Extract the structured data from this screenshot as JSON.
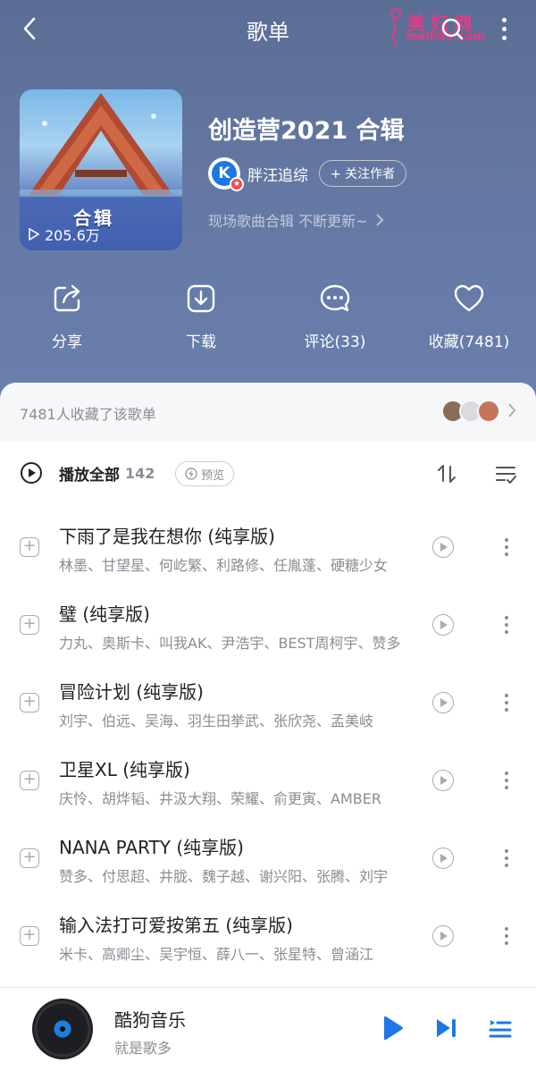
{
  "header": {
    "title": "歌单",
    "watermark_main": "美妇网",
    "watermark_sub": "meili43.com"
  },
  "album": {
    "cover_label": "合辑",
    "plays": "205.6万",
    "title": "创造营2021 合辑",
    "author": "胖汪追综",
    "follow_label": "+ 关注作者",
    "description": "现场歌曲合辑 不断更新~"
  },
  "actions": [
    {
      "label": "分享",
      "icon": "share-icon"
    },
    {
      "label": "下载",
      "icon": "download-icon"
    },
    {
      "label": "评论(33)",
      "icon": "comment-icon"
    },
    {
      "label": "收藏(7481)",
      "icon": "heart-icon"
    }
  ],
  "favorites": {
    "text": "7481人收藏了该歌单"
  },
  "playlist": {
    "play_all_label": "播放全部",
    "count": "142",
    "preview_label": "预览",
    "songs": [
      {
        "title": "下雨了是我在想你 (纯享版)",
        "artists": "林墨、甘望星、何屹繁、利路修、任胤蓬、硬糖少女"
      },
      {
        "title": "璧 (纯享版)",
        "artists": "力丸、奥斯卡、叫我AK、尹浩宇、BEST周柯宇、赞多"
      },
      {
        "title": "冒险计划 (纯享版)",
        "artists": "刘宇、伯远、吴海、羽生田挙武、张欣尧、孟美岐"
      },
      {
        "title": "卫星XL (纯享版)",
        "artists": "庆怜、胡烨韬、井汲大翔、荣耀、俞更寅、AMBER"
      },
      {
        "title": "NANA PARTY (纯享版)",
        "artists": "赞多、付思超、井胧、魏子越、谢兴阳、张腾、刘宇"
      },
      {
        "title": "输入法打可爱按第五 (纯享版)",
        "artists": "米卡、高卿尘、吴宇恒、薛八一、张星特、曾涵江"
      }
    ]
  },
  "player": {
    "title": "酷狗音乐",
    "subtitle": "就是歌多"
  },
  "colors": {
    "accent": "#1d78e6",
    "hero": "#6478a3"
  }
}
